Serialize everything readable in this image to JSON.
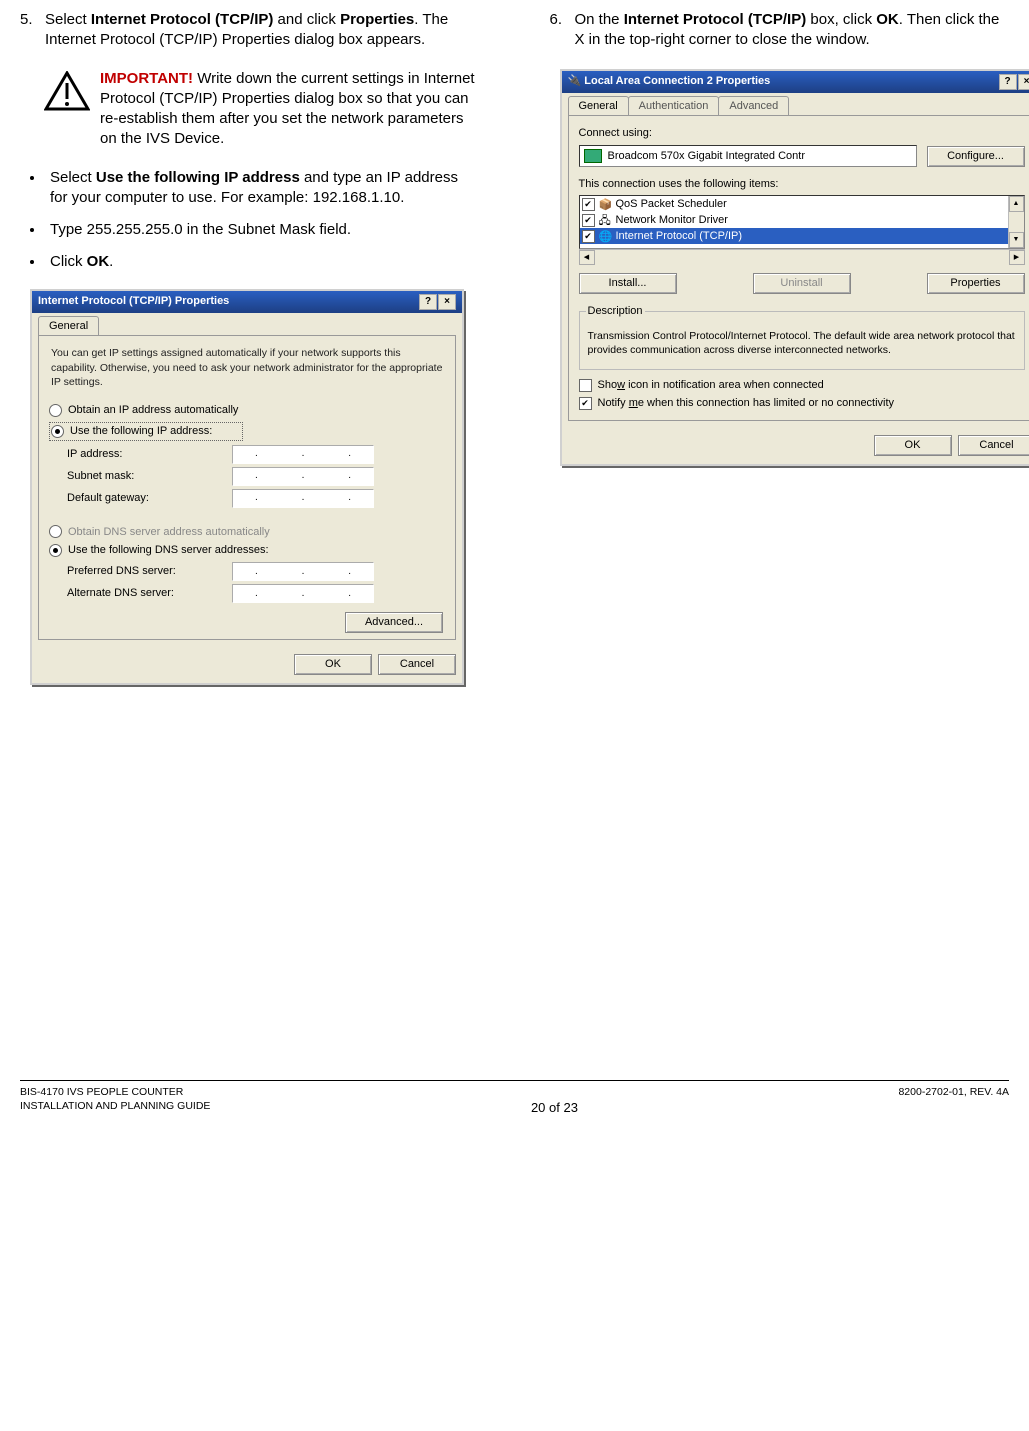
{
  "leftCol": {
    "step5": {
      "num": "5.",
      "text_a": "Select ",
      "bold_a": "Internet Protocol (TCP/IP)",
      "text_b": " and click ",
      "bold_b": "Properties",
      "text_c": ". The Internet Protocol (TCP/IP) Properties dialog box appears."
    },
    "important": {
      "label": "IMPORTANT!",
      "text": " Write down the current settings in Internet Protocol (TCP/IP) Properties dialog box so that you can re-establish them after you set the network parameters on the IVS Device."
    },
    "bullets": [
      {
        "pre": "Select ",
        "bold": "Use the following IP address",
        "post": " and type an IP address for your computer to use. For example: 192.168.1.10."
      },
      {
        "pre": "Type 255.255.255.0 in the Subnet Mask field.",
        "bold": "",
        "post": ""
      },
      {
        "pre": "Click ",
        "bold": "OK",
        "post": "."
      }
    ],
    "dialog1": {
      "title": "Internet Protocol (TCP/IP) Properties",
      "tabs": [
        "General"
      ],
      "intro": "You can get IP settings assigned automatically if your network supports this capability. Otherwise, you need to ask your network administrator for the appropriate IP settings.",
      "radio_auto": "Obtain an IP address automatically",
      "radio_use": "Use the following IP address:",
      "lbl_ip": "IP address:",
      "lbl_mask": "Subnet mask:",
      "lbl_gw": "Default gateway:",
      "radio_dns_auto": "Obtain DNS server address automatically",
      "radio_dns_use": "Use the following DNS server addresses:",
      "lbl_pdns": "Preferred DNS server:",
      "lbl_adns": "Alternate DNS server:",
      "btn_adv": "Advanced...",
      "btn_ok": "OK",
      "btn_cancel": "Cancel"
    }
  },
  "rightCol": {
    "step6": {
      "num": "6.",
      "text_a": "On the ",
      "bold_a": "Internet Protocol (TCP/IP)",
      "text_b": " box, click ",
      "bold_b": "OK",
      "text_c": ". Then click the X in the top-right corner to close the window."
    },
    "dialog2": {
      "title": "Local Area Connection 2 Properties",
      "tabs": [
        "General",
        "Authentication",
        "Advanced"
      ],
      "connect_using": "Connect using:",
      "nic": "Broadcom 570x Gigabit Integrated Contr",
      "btn_configure": "Configure...",
      "uses_following": "This connection uses the following items:",
      "items": [
        {
          "checked": true,
          "label": "QoS Packet Scheduler"
        },
        {
          "checked": true,
          "label": "Network Monitor Driver"
        },
        {
          "checked": true,
          "label": "Internet Protocol (TCP/IP)",
          "selected": true
        }
      ],
      "btn_install": "Install...",
      "btn_uninstall": "Uninstall",
      "btn_properties": "Properties",
      "desc_title": "Description",
      "desc_text": "Transmission Control Protocol/Internet Protocol. The default wide area network protocol that provides communication across diverse interconnected networks.",
      "chk_showicon": "Show icon in notification area when connected",
      "chk_notify": "Notify me when this connection has limited or no connectivity",
      "btn_ok": "OK",
      "btn_cancel": "Cancel"
    }
  },
  "footer": {
    "left1": "BIS-4170 IVS PEOPLE COUNTER",
    "left2": "INSTALLATION AND PLANNING GUIDE",
    "center": "20 of 23",
    "right": "8200-2702-01, REV. 4A"
  }
}
